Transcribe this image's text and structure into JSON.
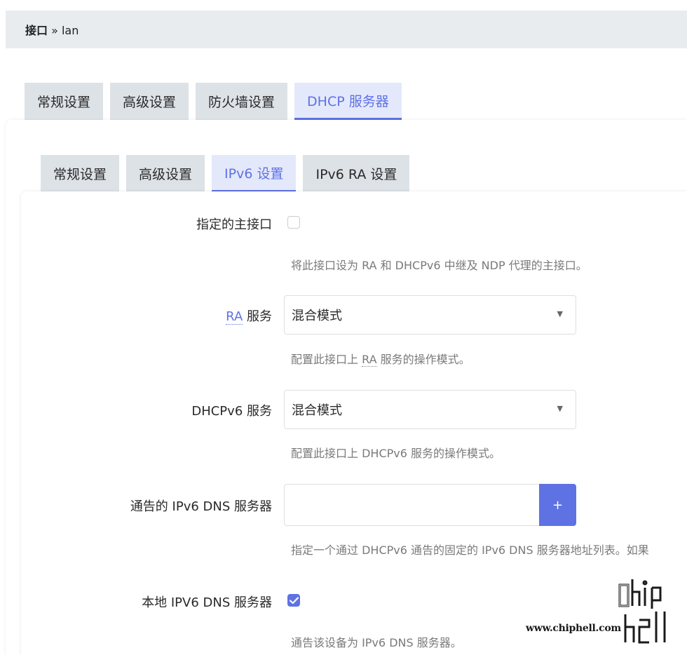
{
  "breadcrumb": {
    "section": "接口",
    "separator": " » ",
    "current": "lan"
  },
  "outer_tabs": [
    {
      "label": "常规设置",
      "active": false
    },
    {
      "label": "高级设置",
      "active": false
    },
    {
      "label": "防火墙设置",
      "active": false
    },
    {
      "label": "DHCP 服务器",
      "active": true
    }
  ],
  "inner_tabs": [
    {
      "label": "常规设置",
      "active": false
    },
    {
      "label": "高级设置",
      "active": false
    },
    {
      "label": "IPv6 设置",
      "active": true
    },
    {
      "label": "IPv6 RA 设置",
      "active": false
    }
  ],
  "fields": {
    "master_interface": {
      "label": "指定的主接口",
      "checked": false,
      "description": "将此接口设为 RA 和 DHCPv6 中继及 NDP 代理的主接口。"
    },
    "ra_service": {
      "label_abbr": "RA",
      "label_rest": " 服务",
      "value": "混合模式",
      "desc_pre": "配置此接口上 ",
      "desc_abbr": "RA",
      "desc_post": " 服务的操作模式。"
    },
    "dhcpv6_service": {
      "label": "DHCPv6 服务",
      "value": "混合模式",
      "description": "配置此接口上 DHCPv6 服务的操作模式。"
    },
    "announced_dns": {
      "label": "通告的 IPv6 DNS 服务器",
      "value": "",
      "add_button": "+",
      "description": "指定一个通过 DHCPv6 通告的固定的 IPv6 DNS 服务器地址列表。如果"
    },
    "local_dns": {
      "label": "本地 IPV6 DNS 服务器",
      "checked": true,
      "description": "通告该设备为 IPv6 DNS 服务器。"
    }
  },
  "watermark": {
    "text": "www.chiphell.com",
    "logo_text": "chip hell"
  },
  "colors": {
    "accent": "#5e72e4",
    "tab_bg": "#dde2e7",
    "breadcrumb_bg": "#e9ecef"
  }
}
